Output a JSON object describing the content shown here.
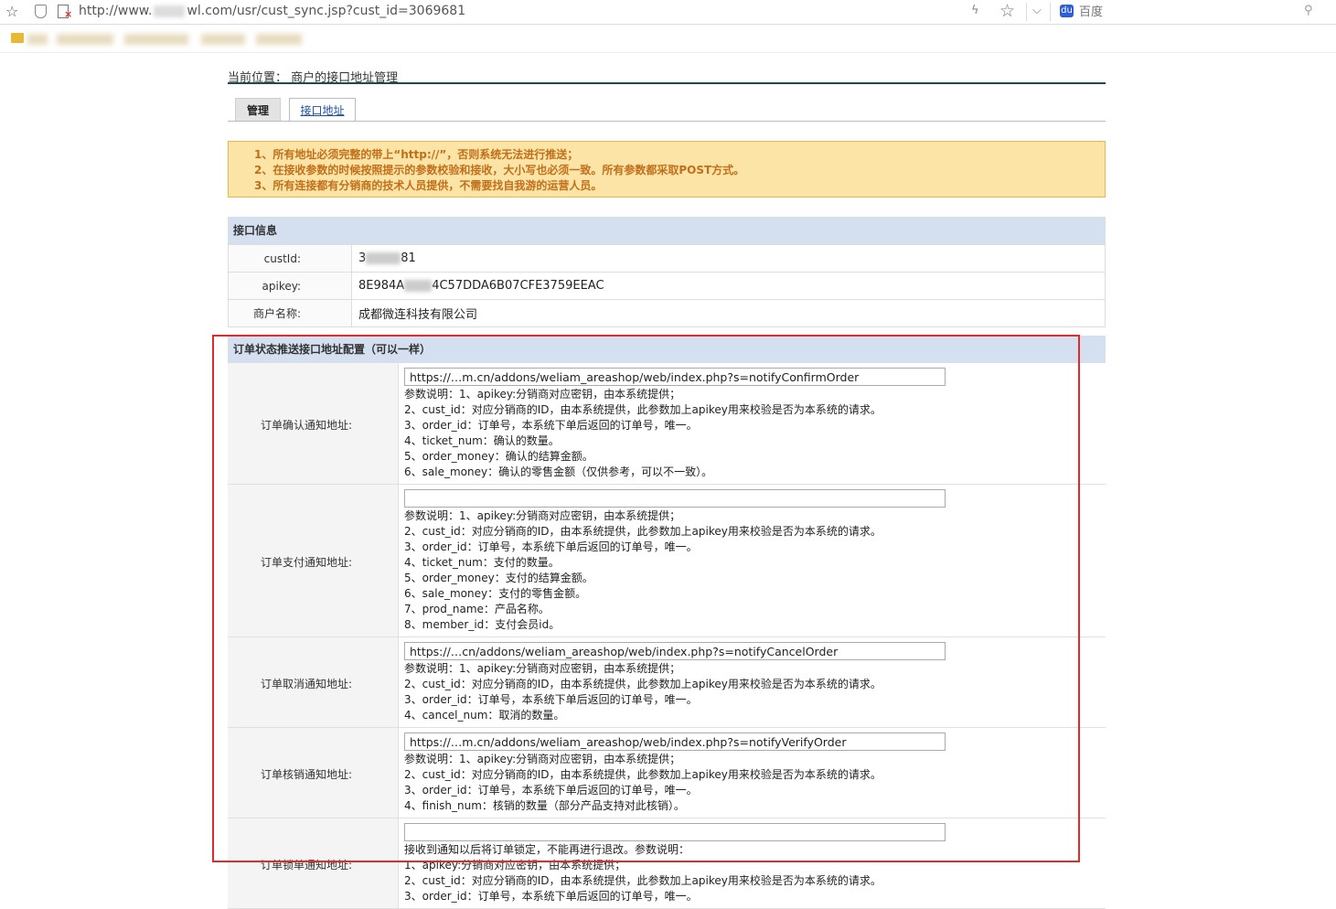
{
  "browser": {
    "url_prefix": "http://www.",
    "url_suffix": "wl.com/usr/cust_sync.jsp?cust_id=3069681",
    "search_placeholder": "百度",
    "baidu_icon": "du"
  },
  "page": {
    "breadcrumb": "当前位置： 商户的接口地址管理",
    "tabs": [
      {
        "label": "管理"
      },
      {
        "label": "接口地址"
      }
    ],
    "notice": [
      "1、所有地址必须完整的带上“http://”，否则系统无法进行推送；",
      "2、在接收参数的时候按照提示的参数校验和接收，大小写也必须一致。所有参数都采取POST方式。",
      "3、所有连接都有分销商的技术人员提供，不需要找自我游的运营人员。"
    ],
    "info": {
      "title": "接口信息",
      "rows": [
        {
          "label": "custId:",
          "value_start": "3",
          "value_end": "81"
        },
        {
          "label": "apikey:",
          "value_start": "8E984A",
          "value_end": "4C57DDA6B07CFE3759EEAC"
        },
        {
          "label": "商户名称:",
          "value": "成都微连科技有限公司"
        }
      ]
    },
    "config": {
      "title": "订单状态推送接口地址配置（可以一样）",
      "rows": [
        {
          "label": "订单确认通知地址:",
          "url": "https://…m.cn/addons/weliam_areashop/web/index.php?s=notifyConfirmOrder",
          "lines": [
            "参数说明：1、apikey:分销商对应密钥，由本系统提供；",
            "2、cust_id：对应分销商的ID，由本系统提供，此参数加上apikey用来校验是否为本系统的请求。",
            "3、order_id：订单号，本系统下单后返回的订单号，唯一。",
            "4、ticket_num：确认的数量。",
            "5、order_money：确认的结算金额。",
            "6、sale_money：确认的零售金额（仅供参考，可以不一致）。"
          ]
        },
        {
          "label": "订单支付通知地址:",
          "url": "",
          "lines": [
            "参数说明：1、apikey:分销商对应密钥，由本系统提供；",
            "2、cust_id：对应分销商的ID，由本系统提供，此参数加上apikey用来校验是否为本系统的请求。",
            "3、order_id：订单号，本系统下单后返回的订单号，唯一。",
            "4、ticket_num：支付的数量。",
            "5、order_money：支付的结算金额。",
            "6、sale_money：支付的零售金额。",
            "7、prod_name：产品名称。",
            "8、member_id：支付会员id。"
          ]
        },
        {
          "label": "订单取消通知地址:",
          "url": "https://…cn/addons/weliam_areashop/web/index.php?s=notifyCancelOrder",
          "lines": [
            "参数说明：1、apikey:分销商对应密钥，由本系统提供；",
            "2、cust_id：对应分销商的ID，由本系统提供，此参数加上apikey用来校验是否为本系统的请求。",
            "3、order_id：订单号，本系统下单后返回的订单号，唯一。",
            "4、cancel_num：取消的数量。"
          ]
        },
        {
          "label": "订单核销通知地址:",
          "url": "https://…m.cn/addons/weliam_areashop/web/index.php?s=notifyVerifyOrder",
          "lines": [
            "参数说明：1、apikey:分销商对应密钥，由本系统提供；",
            "2、cust_id：对应分销商的ID，由本系统提供，此参数加上apikey用来校验是否为本系统的请求。",
            "3、order_id：订单号，本系统下单后返回的订单号，唯一。",
            "4、finish_num：核销的数量（部分产品支持对此核销）。"
          ]
        },
        {
          "label": "订单锁单通知地址:",
          "url": "",
          "lines": [
            "接收到通知以后将订单锁定，不能再进行退改。参数说明：",
            "1、apikey:分销商对应密钥，由本系统提供；",
            "2、cust_id：对应分销商的ID，由本系统提供，此参数加上apikey用来校验是否为本系统的请求。",
            "3、order_id：订单号，本系统下单后返回的订单号，唯一。"
          ]
        }
      ]
    }
  }
}
